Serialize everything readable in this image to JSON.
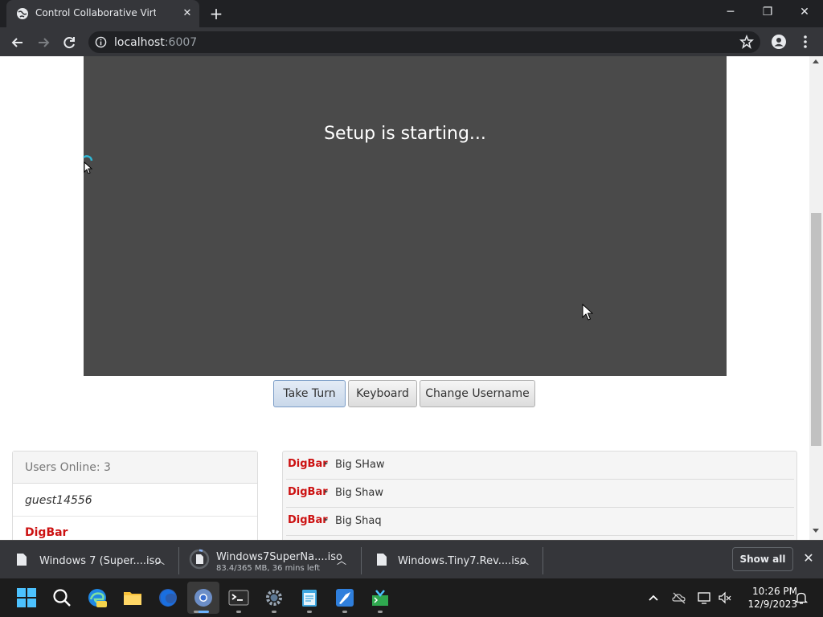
{
  "browser": {
    "tab_title": "Control Collaborative Virtual Machine",
    "url_host": "localhost",
    "url_port": ":6007",
    "new_tab_symbol": "+",
    "close_symbol": "✕",
    "minimize_symbol": "─",
    "restore_symbol": "❐"
  },
  "vm": {
    "screen_text": "Setup is starting...",
    "buttons": {
      "take_turn": "Take Turn",
      "keyboard": "Keyboard",
      "change_username": "Change Username"
    }
  },
  "users": {
    "header": "Users Online: 3",
    "list": [
      {
        "name": "guest14556",
        "style": "guest"
      },
      {
        "name": "DigBar",
        "style": "highlight"
      }
    ]
  },
  "chat": {
    "messages": [
      {
        "user": "DigBar",
        "text": "Big SHaw"
      },
      {
        "user": "DigBar",
        "text": "Big Shaw"
      },
      {
        "user": "DigBar",
        "text": "Big Shaq"
      }
    ]
  },
  "downloads": {
    "items": [
      {
        "name": "Windows 7 (Super....iso",
        "sub": ""
      },
      {
        "name": "Windows7SuperNa....iso",
        "sub": "83.4/365 MB, 36 mins left"
      },
      {
        "name": "Windows.Tiny7.Rev....iso",
        "sub": ""
      }
    ],
    "show_all": "Show all"
  },
  "taskbar": {
    "time": "10:26 PM",
    "date": "12/9/2023",
    "icons": [
      "start-icon",
      "search-icon",
      "edge-icon",
      "file-explorer-icon",
      "firefox-icon",
      "chrome-icon",
      "terminal-icon",
      "settings-icon",
      "notepad-icon",
      "paint-icon",
      "installer-icon"
    ]
  },
  "colors": {
    "chat_user": "#cc1111",
    "vm_bg": "#4a4a4a",
    "chrome_dark": "#202124",
    "chrome_toolbar": "#35363a"
  }
}
